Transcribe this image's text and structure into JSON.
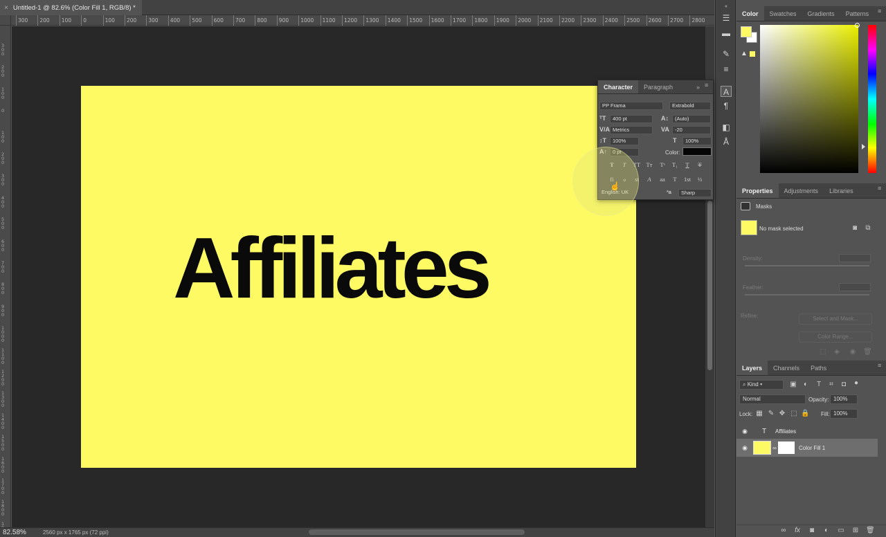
{
  "document": {
    "tab_title": "Untitled-1 @ 82.6% (Color Fill 1, RGB/8) *",
    "canvas_text": "Affiliates",
    "canvas_color": "#fdfa64"
  },
  "rulers": {
    "horizontal": [
      "300",
      "200",
      "100",
      "0",
      "100",
      "200",
      "300",
      "400",
      "500",
      "600",
      "700",
      "800",
      "900",
      "1000",
      "1100",
      "1200",
      "1300",
      "1400",
      "1500",
      "1600",
      "1700",
      "1800",
      "1900",
      "2000",
      "2100",
      "2200",
      "2300",
      "2400",
      "2500",
      "2600",
      "2700",
      "2800"
    ],
    "vertical": [
      "300",
      "200",
      "100",
      "0",
      "100",
      "200",
      "300",
      "400",
      "500",
      "600",
      "700",
      "800",
      "900",
      "1000",
      "1100",
      "1200",
      "1300",
      "1400",
      "1500",
      "1600",
      "1700",
      "1800",
      "1900"
    ]
  },
  "statusbar": {
    "zoom": "82.58%",
    "doc_size": "2560 px x 1765 px (72 ppi)"
  },
  "color_panel": {
    "tabs": [
      "Color",
      "Swatches",
      "Gradients",
      "Patterns"
    ],
    "foreground": "#fdfa64",
    "background": "#ffffff"
  },
  "properties_panel": {
    "tabs": [
      "Properties",
      "Adjustments",
      "Libraries"
    ],
    "masks_label": "Masks",
    "no_mask": "No mask selected",
    "density": "Density:",
    "feather": "Feather:",
    "refine": "Refine:",
    "select_mask": "Select and Mask...",
    "color_range": "Color Range..."
  },
  "layers_panel": {
    "tabs": [
      "Layers",
      "Channels",
      "Paths"
    ],
    "filter_kind": "Kind",
    "blend_mode": "Normal",
    "opacity_label": "Opacity:",
    "opacity_value": "100%",
    "lock_label": "Lock:",
    "fill_label": "Fill:",
    "fill_value": "100%",
    "layers": [
      {
        "name": "Affiliates",
        "type": "text",
        "selected": false
      },
      {
        "name": "Color Fill 1",
        "type": "fill",
        "selected": true
      }
    ]
  },
  "character_panel": {
    "tabs": [
      "Character",
      "Paragraph"
    ],
    "font_family": "PP Frama",
    "font_style": "Extrabold",
    "font_size": "400 pt",
    "leading": "(Auto)",
    "kerning": "Metrics",
    "tracking": "-20",
    "vertical_scale": "100%",
    "horizontal_scale": "100%",
    "baseline": "0 pt",
    "color_label": "Color:",
    "color_value": "#050505",
    "language": "English: UK",
    "antialias": "Sharp",
    "ot_first": "fi",
    "ot_ordinal": "1st",
    "ot_fraction": "½"
  }
}
